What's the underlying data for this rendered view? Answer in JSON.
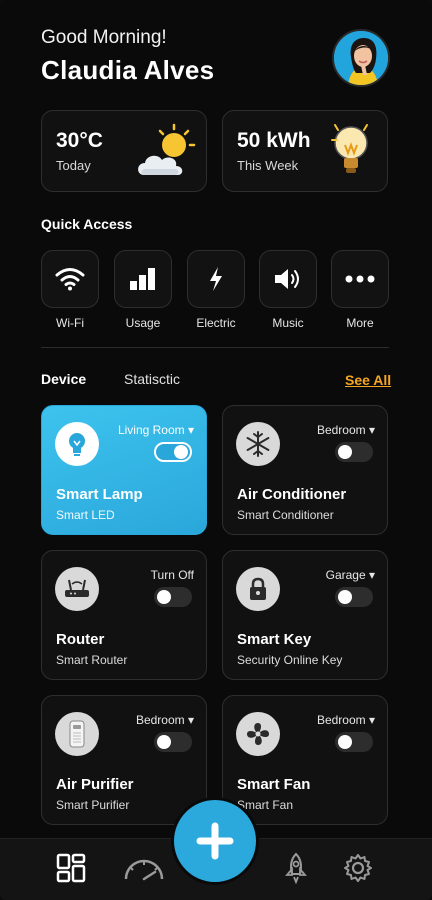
{
  "header": {
    "greeting": "Good Morning!",
    "user_name": "Claudia Alves"
  },
  "stats": [
    {
      "value": "30°C",
      "label": "Today",
      "icon": "sun-cloud-icon"
    },
    {
      "value": "50 kWh",
      "label": "This Week",
      "icon": "lightbulb-icon"
    }
  ],
  "quick_access": {
    "title": "Quick Access",
    "items": [
      {
        "label": "Wi-Fi",
        "icon": "wifi-icon"
      },
      {
        "label": "Usage",
        "icon": "bar-chart-icon"
      },
      {
        "label": "Electric",
        "icon": "lightning-icon"
      },
      {
        "label": "Music",
        "icon": "speaker-icon"
      },
      {
        "label": "More",
        "icon": "more-dots-icon"
      }
    ]
  },
  "tabs": {
    "device": "Device",
    "statistic": "Statisctic",
    "see_all": "See All"
  },
  "devices": [
    {
      "name": "Smart Lamp",
      "subtitle": "Smart LED",
      "room": "Living Room ▾",
      "on": true,
      "icon": "lightbulb-icon"
    },
    {
      "name": "Air Conditioner",
      "subtitle": "Smart Conditioner",
      "room": "Bedroom ▾",
      "on": false,
      "icon": "snowflake-icon"
    },
    {
      "name": "Router",
      "subtitle": "Smart Router",
      "room": "Turn Off",
      "on": false,
      "icon": "router-icon"
    },
    {
      "name": "Smart Key",
      "subtitle": "Security Online Key",
      "room": "Garage ▾",
      "on": false,
      "icon": "lock-icon"
    },
    {
      "name": "Air Purifier",
      "subtitle": "Smart Purifier",
      "room": "Bedroom ▾",
      "on": false,
      "icon": "purifier-icon"
    },
    {
      "name": "Smart Fan",
      "subtitle": "Smart Fan",
      "room": "Bedroom ▾",
      "on": false,
      "icon": "fan-icon"
    }
  ],
  "nav": {
    "items": [
      "dashboard-icon",
      "speedometer-icon",
      "add-icon",
      "rocket-icon",
      "settings-gear-icon"
    ]
  },
  "colors": {
    "accent": "#2aa7da",
    "link": "#f5a524",
    "background": "#0a0a0a"
  }
}
